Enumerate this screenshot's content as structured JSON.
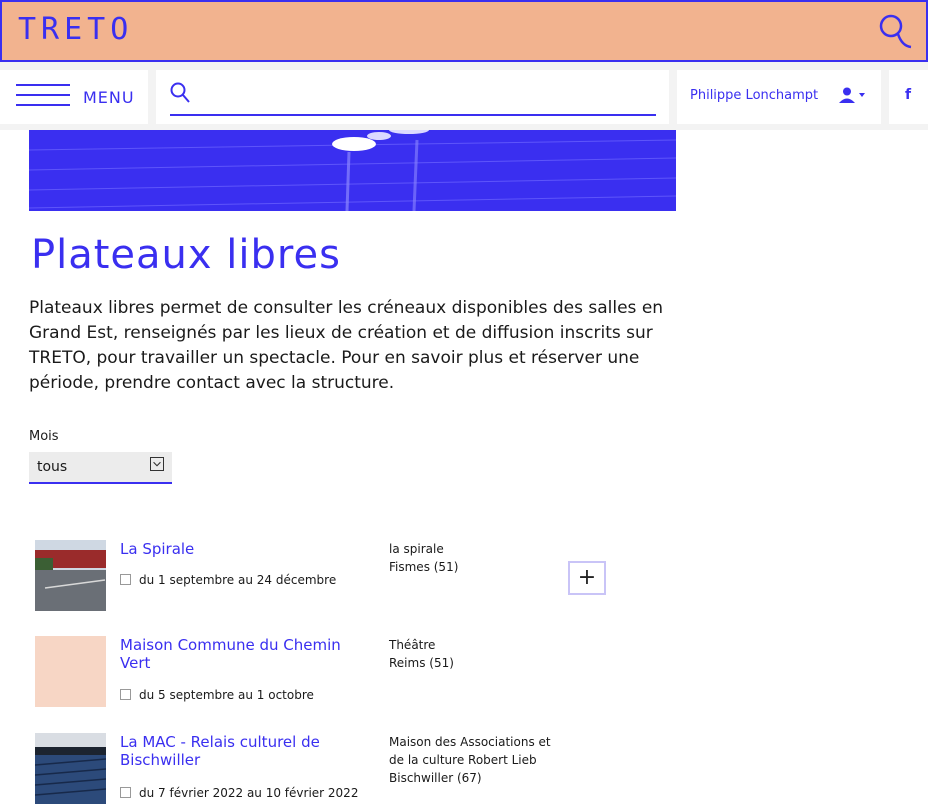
{
  "brand": "TRETO",
  "menu": {
    "label": "MENU"
  },
  "search": {
    "placeholder": ""
  },
  "user": {
    "name": "Philippe Lonchampt"
  },
  "social": {
    "facebook": "f"
  },
  "page": {
    "title": "Plateaux libres",
    "intro": "Plateaux libres permet de consulter les créneaux disponibles des salles en Grand Est, renseignés par les lieux de création et de diffusion inscrits sur TRETO, pour travailler un spectacle. Pour en savoir plus et réserver une période, prendre contact avec la structure."
  },
  "filter": {
    "label": "Mois",
    "value": "tous"
  },
  "items": [
    {
      "title": "La Spirale",
      "date": "du 1 septembre au 24 décembre",
      "place_line1": "la spirale",
      "place_line2": "Fismes (51)",
      "place_line3": ""
    },
    {
      "title": "Maison Commune du Chemin Vert",
      "date": "du 5 septembre au 1 octobre",
      "place_line1": "Théâtre",
      "place_line2": "Reims (51)",
      "place_line3": ""
    },
    {
      "title": "La MAC - Relais culturel de Bischwiller",
      "date": "du 7 février 2022 au 10 février 2022",
      "place_line1": "Maison des Associations et",
      "place_line2": "de la culture Robert Lieb",
      "place_line3": "Bischwiller (67)"
    }
  ],
  "expand_label": "+",
  "colors": {
    "accent": "#3a2ff0",
    "brand_bar": "#f2b38f"
  }
}
